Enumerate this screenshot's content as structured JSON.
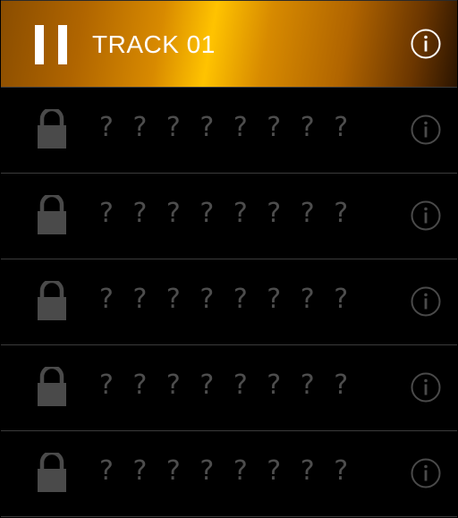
{
  "tracks": [
    {
      "title": "TRACK 01",
      "state": "playing",
      "icon": "pause-icon",
      "info_icon": "info-icon"
    },
    {
      "title": "? ? ? ? ? ? ? ?",
      "state": "locked",
      "icon": "lock-icon",
      "info_icon": "info-icon"
    },
    {
      "title": "? ? ? ? ? ? ? ?",
      "state": "locked",
      "icon": "lock-icon",
      "info_icon": "info-icon"
    },
    {
      "title": "? ? ? ? ? ? ? ?",
      "state": "locked",
      "icon": "lock-icon",
      "info_icon": "info-icon"
    },
    {
      "title": "? ? ? ? ? ? ? ?",
      "state": "locked",
      "icon": "lock-icon",
      "info_icon": "info-icon"
    },
    {
      "title": "? ? ? ? ? ? ? ?",
      "state": "locked",
      "icon": "lock-icon",
      "info_icon": "info-icon"
    }
  ],
  "colors": {
    "active_gradient_highlight": "#ffc300",
    "active_gradient_dark": "#2b1400",
    "locked_text": "#4d4d4d",
    "locked_icon": "#4a4a4a",
    "divider": "#3b3b3b"
  }
}
